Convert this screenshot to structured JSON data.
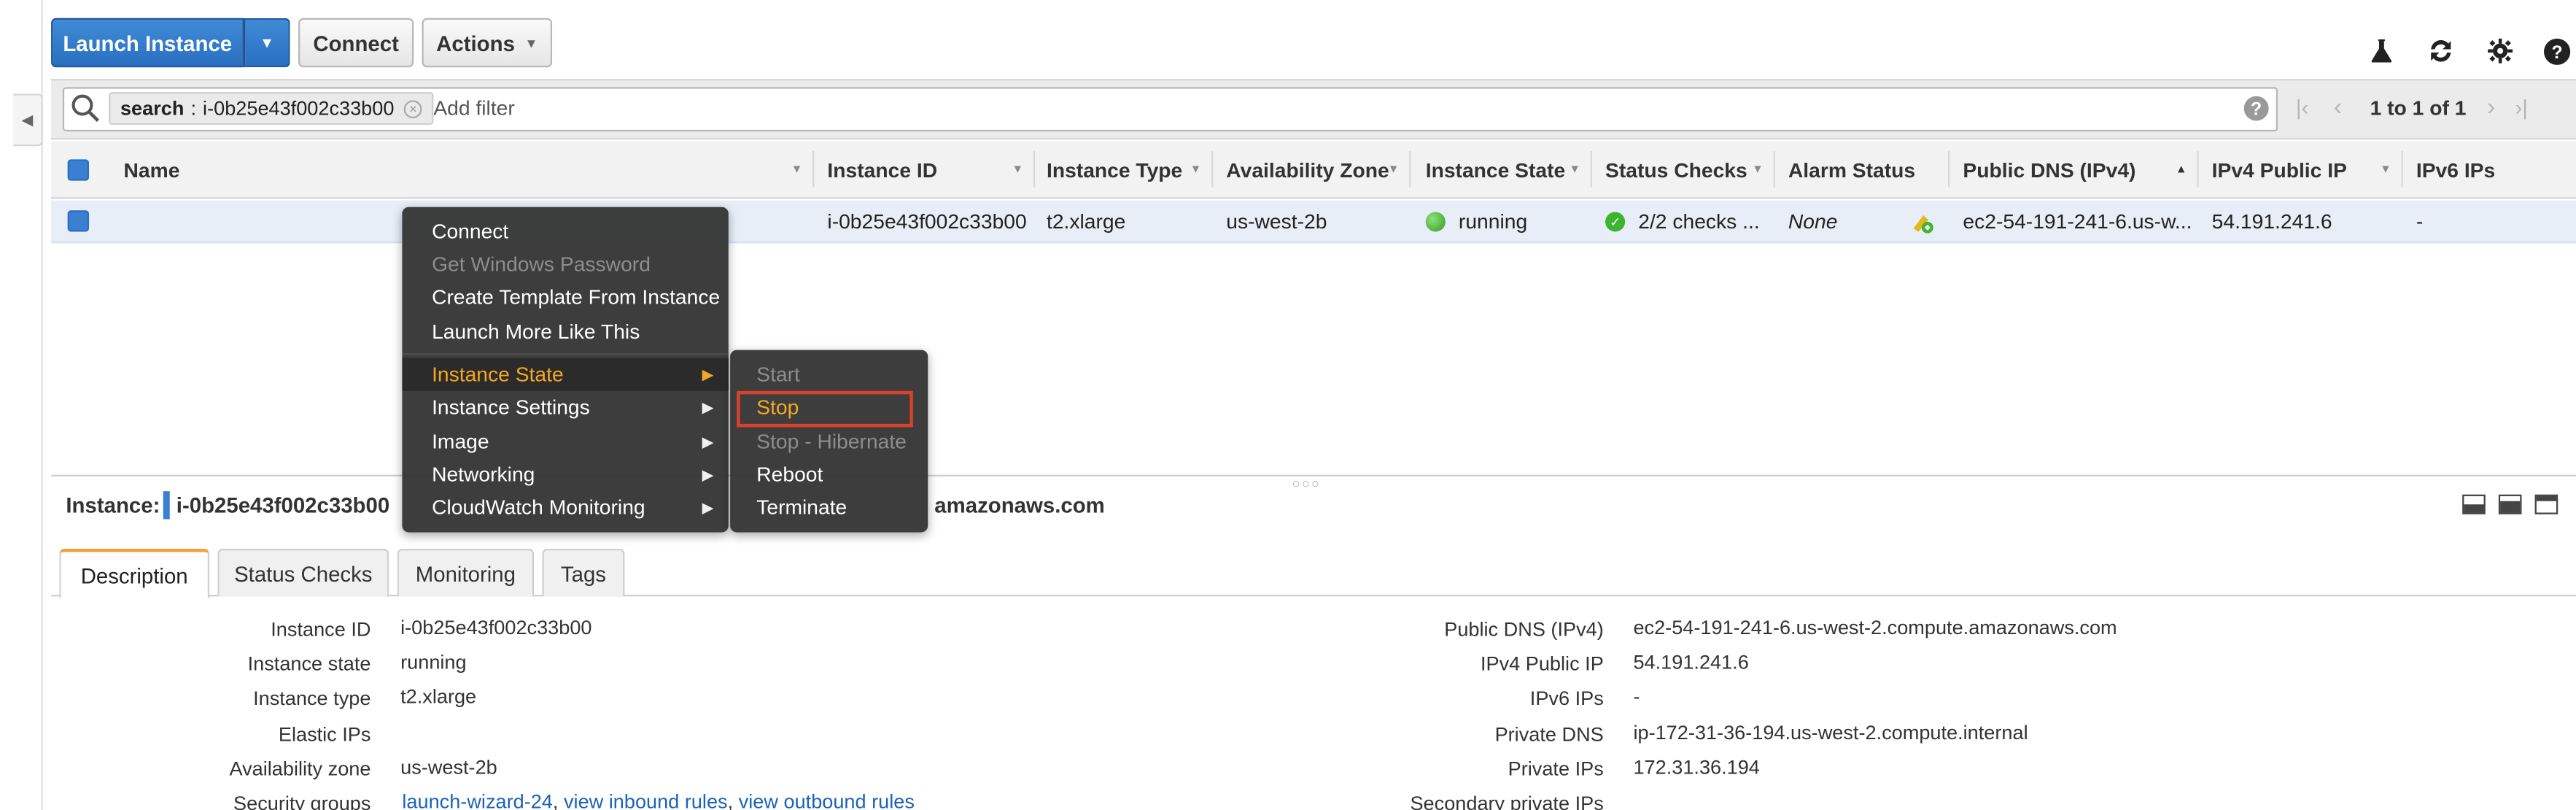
{
  "toolbar": {
    "launch_label": "Launch Instance",
    "connect_label": "Connect",
    "actions_label": "Actions"
  },
  "icons": {
    "flask": "flask-icon",
    "refresh": "refresh-icon",
    "settings": "gear-icon",
    "help": "help-icon",
    "search": "search-icon"
  },
  "filter": {
    "token_label": "search",
    "token_value": "i-0b25e43f002c33b00",
    "add_filter_placeholder": "Add filter",
    "pagination_text": "1 to 1 of 1"
  },
  "table": {
    "columns": [
      "Name",
      "Instance ID",
      "Instance Type",
      "Availability Zone",
      "Instance State",
      "Status Checks",
      "Alarm Status",
      "Public DNS (IPv4)",
      "IPv4 Public IP",
      "IPv6 IPs"
    ],
    "row": {
      "name": "",
      "instance_id": "i-0b25e43f002c33b00",
      "instance_type": "t2.xlarge",
      "availability_zone": "us-west-2b",
      "instance_state": "running",
      "status_checks": "2/2 checks ...",
      "alarm_status": "None",
      "public_dns": "ec2-54-191-241-6.us-w...",
      "ipv4_public_ip": "54.191.241.6",
      "ipv6_ips": "-"
    }
  },
  "context_menu": {
    "items": [
      "Connect",
      "Get Windows Password",
      "Create Template From Instance",
      "Launch More Like This"
    ],
    "submenu_items": [
      "Instance State",
      "Instance Settings",
      "Image",
      "Networking",
      "CloudWatch Monitoring"
    ],
    "instance_state_submenu": [
      "Start",
      "Stop",
      "Stop - Hibernate",
      "Reboot",
      "Terminate"
    ]
  },
  "details": {
    "instance_label": "Instance:",
    "instance_id": "i-0b25e43f002c33b00",
    "title_suffix": "amazonaws.com",
    "tabs": [
      "Description",
      "Status Checks",
      "Monitoring",
      "Tags"
    ],
    "left_fields": [
      {
        "label": "Instance ID",
        "value": "i-0b25e43f002c33b00"
      },
      {
        "label": "Instance state",
        "value": "running"
      },
      {
        "label": "Instance type",
        "value": "t2.xlarge"
      },
      {
        "label": "Elastic IPs",
        "value": ""
      },
      {
        "label": "Availability zone",
        "value": "us-west-2b"
      },
      {
        "label": "Security groups",
        "value": ""
      }
    ],
    "security_groups_links": [
      "launch-wizard-24",
      "view inbound rules",
      "view outbound rules"
    ],
    "right_fields": [
      {
        "label": "Public DNS (IPv4)",
        "value": "ec2-54-191-241-6.us-west-2.compute.amazonaws.com"
      },
      {
        "label": "IPv4 Public IP",
        "value": "54.191.241.6"
      },
      {
        "label": "IPv6 IPs",
        "value": "-"
      },
      {
        "label": "Private DNS",
        "value": "ip-172-31-36-194.us-west-2.compute.internal"
      },
      {
        "label": "Private IPs",
        "value": "172.31.36.194"
      },
      {
        "label": "Secondary private IPs",
        "value": ""
      }
    ]
  },
  "colors": {
    "primary": "#2a6fc1",
    "menu_bg": "#353535",
    "menu_highlight": "#f5a623",
    "stop_outline": "#d9412b",
    "running_green": "#3cb52f",
    "link": "#1a63b8"
  }
}
